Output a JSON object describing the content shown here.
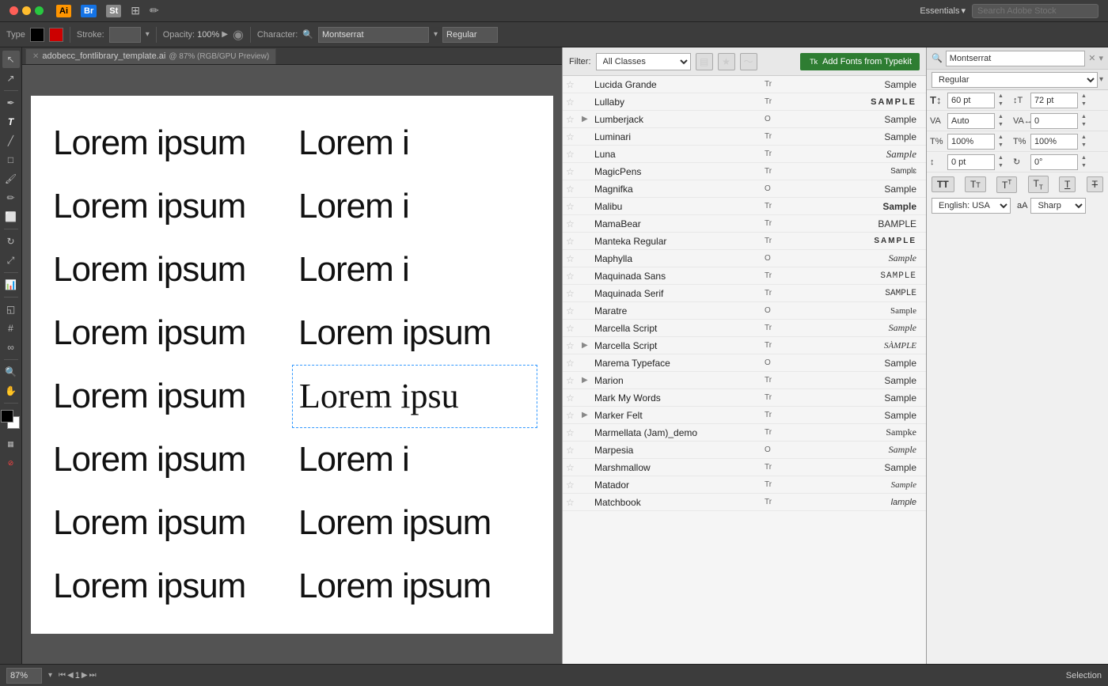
{
  "titleBar": {
    "essentials": "Essentials",
    "searchPlaceholder": "Search Adobe Stock"
  },
  "toolbar": {
    "typeLabel": "Type",
    "strokeLabel": "Stroke:",
    "opacityLabel": "Opacity:",
    "opacityValue": "100%",
    "characterLabel": "Character:",
    "fontName": "Montserrat",
    "fontStyle": "Regular"
  },
  "canvasTab": {
    "filename": "adobecc_fontlibrary_template.ai",
    "subtitle": "@ 87% (RGB/GPU Preview)"
  },
  "canvas": {
    "loremTexts": [
      "Lorem ipsum",
      "Lorem i",
      "Lorem ipsum",
      "Lorem i",
      "Lorem ipsum",
      "Lorem i",
      "Lorem ipsum",
      "Lorem ipsum",
      "Lorem ipsum",
      "Lorem ipsu",
      "Lorem ipsum",
      "Lorem i",
      "Lorem ipsum",
      "Lorem ipsum",
      "Lorem ipsum",
      "Lorem ipsum"
    ]
  },
  "fontPanel": {
    "filterLabel": "Filter:",
    "filterValue": "All Classes",
    "addFontsLabel": "Add Fonts from Typekit",
    "fonts": [
      {
        "name": "Lucida Grande",
        "expand": false,
        "sample": "Sample",
        "sampleStyle": "normal",
        "typeIcon": "Tr"
      },
      {
        "name": "Lullaby",
        "expand": false,
        "sample": "SAMPLE",
        "sampleStyle": "caps",
        "typeIcon": "Tr"
      },
      {
        "name": "Lumberjack",
        "expand": true,
        "sample": "Sample",
        "sampleStyle": "normal",
        "typeIcon": "O"
      },
      {
        "name": "Luminari",
        "expand": false,
        "sample": "Sample",
        "sampleStyle": "normal",
        "typeIcon": "Tr"
      },
      {
        "name": "Luna",
        "expand": false,
        "sample": "Sample",
        "sampleStyle": "script",
        "typeIcon": "Tr"
      },
      {
        "name": "MagicPens",
        "expand": false,
        "sample": "Samplɛ",
        "sampleStyle": "small",
        "typeIcon": "Tr"
      },
      {
        "name": "Magnifka",
        "expand": false,
        "sample": "Sample",
        "sampleStyle": "normal",
        "typeIcon": "O"
      },
      {
        "name": "Malibu",
        "expand": false,
        "sample": "Sample",
        "sampleStyle": "bold",
        "typeIcon": "Tr"
      },
      {
        "name": "MamaBear",
        "expand": false,
        "sample": "BAMPLE",
        "sampleStyle": "normal",
        "typeIcon": "Tr"
      },
      {
        "name": "Manteka Regular",
        "expand": false,
        "sample": "SAMPLE",
        "sampleStyle": "wide",
        "typeIcon": "Tr"
      },
      {
        "name": "Maphylla",
        "expand": false,
        "sample": "Sample",
        "sampleStyle": "script2",
        "typeIcon": "O"
      },
      {
        "name": "Maquinada Sans",
        "expand": false,
        "sample": "SAMPLE",
        "sampleStyle": "stencil",
        "typeIcon": "Tr"
      },
      {
        "name": "Maquinada Serif",
        "expand": false,
        "sample": "SAMPLE",
        "sampleStyle": "stencil2",
        "typeIcon": "Tr"
      },
      {
        "name": "Maratre",
        "expand": false,
        "sample": "Sample",
        "sampleStyle": "script3",
        "typeIcon": "O"
      },
      {
        "name": "Marcella Script",
        "expand": false,
        "sample": "Sample",
        "sampleStyle": "script4",
        "typeIcon": "Tr"
      },
      {
        "name": "Marcella Script",
        "expand": true,
        "sample": "SÀMPLE",
        "sampleStyle": "decorative",
        "typeIcon": "Tr"
      },
      {
        "name": "Marema Typeface",
        "expand": false,
        "sample": "Sample",
        "sampleStyle": "normal",
        "typeIcon": "O"
      },
      {
        "name": "Marion",
        "expand": true,
        "sample": "Sample",
        "sampleStyle": "normal",
        "typeIcon": "Tr"
      },
      {
        "name": "Mark My Words",
        "expand": false,
        "sample": "Sample",
        "sampleStyle": "normal",
        "typeIcon": "Tr"
      },
      {
        "name": "Marker Felt",
        "expand": true,
        "sample": "Sample",
        "sampleStyle": "normal",
        "typeIcon": "Tr"
      },
      {
        "name": "Marmellata (Jam)_demo",
        "expand": false,
        "sample": "Sampke",
        "sampleStyle": "brush",
        "typeIcon": "Tr"
      },
      {
        "name": "Marpesia",
        "expand": false,
        "sample": "Sample",
        "sampleStyle": "italic",
        "typeIcon": "O"
      },
      {
        "name": "Marshmallow",
        "expand": false,
        "sample": "Sample",
        "sampleStyle": "rounded",
        "typeIcon": "Tr"
      },
      {
        "name": "Matador",
        "expand": false,
        "sample": "Sample",
        "sampleStyle": "script5",
        "typeIcon": "Tr"
      },
      {
        "name": "Matchbook",
        "expand": false,
        "sample": "lample",
        "sampleStyle": "small2",
        "typeIcon": "Tr"
      }
    ]
  },
  "charPanel": {
    "searchValue": "Montserrat",
    "styleValue": "Regular",
    "fields": [
      {
        "icon": "T↕",
        "value": "60 pt",
        "label": "",
        "unit": "pt",
        "icon2": "T↔",
        "value2": "72 pt",
        "unit2": "pt"
      },
      {
        "icon": "VA",
        "value": "Auto",
        "label": "",
        "unit": "",
        "icon2": "VA↔",
        "value2": "0",
        "unit2": ""
      },
      {
        "icon": "T%",
        "value": "100%",
        "label": "",
        "unit": "%",
        "icon2": "T%↔",
        "value2": "100%",
        "unit2": "%"
      },
      {
        "icon": "↕pt",
        "value": "0 pt",
        "label": "",
        "unit": "pt",
        "icon2": "↻",
        "value2": "0°",
        "unit2": "°"
      }
    ],
    "formatButtons": [
      "TT",
      "Tt",
      "T̲T̲",
      "T̲",
      "T",
      "T"
    ],
    "languageValue": "English: USA",
    "sharpValue": "Sharp"
  },
  "statusBar": {
    "zoom": "87%",
    "page": "1",
    "mode": "Selection"
  }
}
